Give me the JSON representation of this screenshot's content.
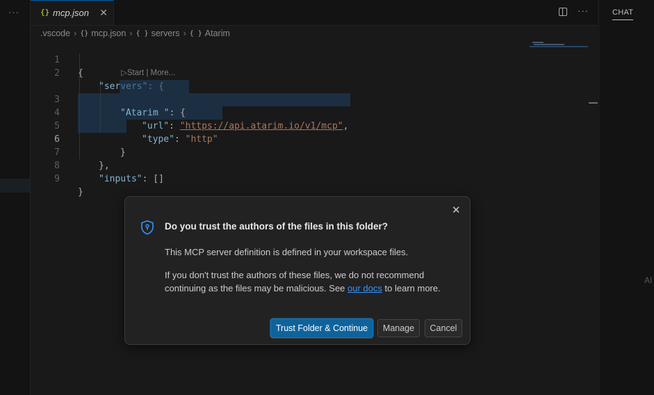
{
  "left": {
    "more": "···"
  },
  "tab": {
    "icon": "{}",
    "label": "mcp.json",
    "close": "✕"
  },
  "editor_actions": {
    "split_icon": "split-editor-icon",
    "more": "···"
  },
  "breadcrumb": {
    "items": [
      ".vscode",
      "mcp.json",
      "servers",
      "Atarim"
    ],
    "icons": [
      "",
      "{}",
      "{ }",
      "{ }"
    ],
    "sep": "›"
  },
  "code": {
    "line_numbers": [
      "1",
      "2",
      "3",
      "4",
      "5",
      "6",
      "7",
      "8",
      "9"
    ],
    "l1": "{",
    "l2_key": "\"servers\"",
    "l2_rest": ": {",
    "codelens": "▷Start | More...",
    "l3_key": "\"Atarim \"",
    "l3_rest": ": {",
    "l4_key": "\"url\"",
    "l4_colon": ": ",
    "l4_val": "\"https://api.atarim.io/v1/mcp\"",
    "l4_end": ",",
    "l5_key": "\"type\"",
    "l5_colon": ": ",
    "l5_val": "\"http\"",
    "l6": "}",
    "l7": "},",
    "l8_key": "\"inputs\"",
    "l8_rest": ": []",
    "l9": "}"
  },
  "chat": {
    "tab_label": "CHAT",
    "ai_text": "AI"
  },
  "dialog": {
    "close": "✕",
    "icon": "shield-icon",
    "title": "Do you trust the authors of the files in this folder?",
    "p1": "This MCP server definition is defined in your workspace files.",
    "p2_before": "If you don't trust the authors of these files, we do not recommend continuing as the files may be malicious. See ",
    "p2_link": "our docs",
    "p2_after": " to learn more.",
    "buttons": {
      "primary": "Trust Folder & Continue",
      "manage": "Manage",
      "cancel": "Cancel"
    }
  },
  "colors": {
    "accent": "#0e639c",
    "link": "#3794ff",
    "string": "#ce9178",
    "key": "#9cdcfe",
    "selection": "#264f78"
  }
}
